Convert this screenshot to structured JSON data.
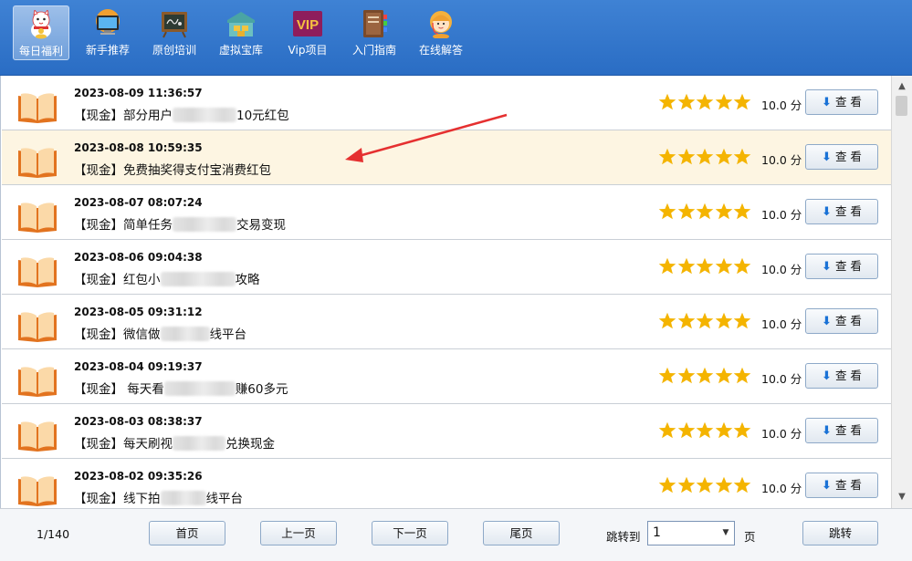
{
  "toolbar": {
    "items": [
      {
        "label": "每日福利",
        "icon": "lucky-cat-icon",
        "active": true
      },
      {
        "label": "新手推荐",
        "icon": "monitor-icon",
        "active": false
      },
      {
        "label": "原创培训",
        "icon": "chalkboard-icon",
        "active": false
      },
      {
        "label": "虚拟宝库",
        "icon": "warehouse-icon",
        "active": false
      },
      {
        "label": "Vip项目",
        "icon": "vip-icon",
        "active": false
      },
      {
        "label": "入门指南",
        "icon": "guide-book-icon",
        "active": false
      },
      {
        "label": "在线解答",
        "icon": "support-agent-icon",
        "active": false
      }
    ],
    "vip_badge": "VIP"
  },
  "list": {
    "rating_stars": 5,
    "star_color": "#f4b400",
    "view_label": "查 看",
    "highlight_color": "#fdf5e2",
    "rows": [
      {
        "date": "2023-08-09 11:36:57",
        "title_a": "【现金】部分用户",
        "title_b": "10元红包",
        "score": "10.0 分",
        "highlight": false
      },
      {
        "date": "2023-08-08 10:59:35",
        "title_a": "【现金】免费抽奖得支付宝消费红包",
        "title_b": "",
        "score": "10.0 分",
        "highlight": true
      },
      {
        "date": "2023-08-07 08:07:24",
        "title_a": "【现金】简单任务",
        "title_b": "交易变现",
        "score": "10.0 分",
        "highlight": false
      },
      {
        "date": "2023-08-06 09:04:38",
        "title_a": "【现金】红包小",
        "title_b": "攻略",
        "score": "10.0 分",
        "highlight": false
      },
      {
        "date": "2023-08-05 09:31:12",
        "title_a": "【现金】微信做",
        "title_b": "线平台",
        "score": "10.0 分",
        "highlight": false
      },
      {
        "date": "2023-08-04 09:19:37",
        "title_a": "【现金】 每天看",
        "title_b": "赚60多元",
        "score": "10.0 分",
        "highlight": false
      },
      {
        "date": "2023-08-03 08:38:37",
        "title_a": "【现金】每天刷视",
        "title_b": "兑换现金",
        "score": "10.0 分",
        "highlight": false
      },
      {
        "date": "2023-08-02 09:35:26",
        "title_a": "【现金】线下拍",
        "title_b": "线平台",
        "score": "10.0 分",
        "highlight": false
      }
    ]
  },
  "pager": {
    "count": "1/140",
    "first": "首页",
    "prev": "上一页",
    "next": "下一页",
    "last": "尾页",
    "jump_label": "跳转到",
    "page_value": "1",
    "page_unit": "页",
    "jump_button": "跳转"
  },
  "colors": {
    "toolbar_bg": "#2f74cc",
    "annotation_arrow": "#e53030",
    "button_border": "#8ea9c8"
  }
}
